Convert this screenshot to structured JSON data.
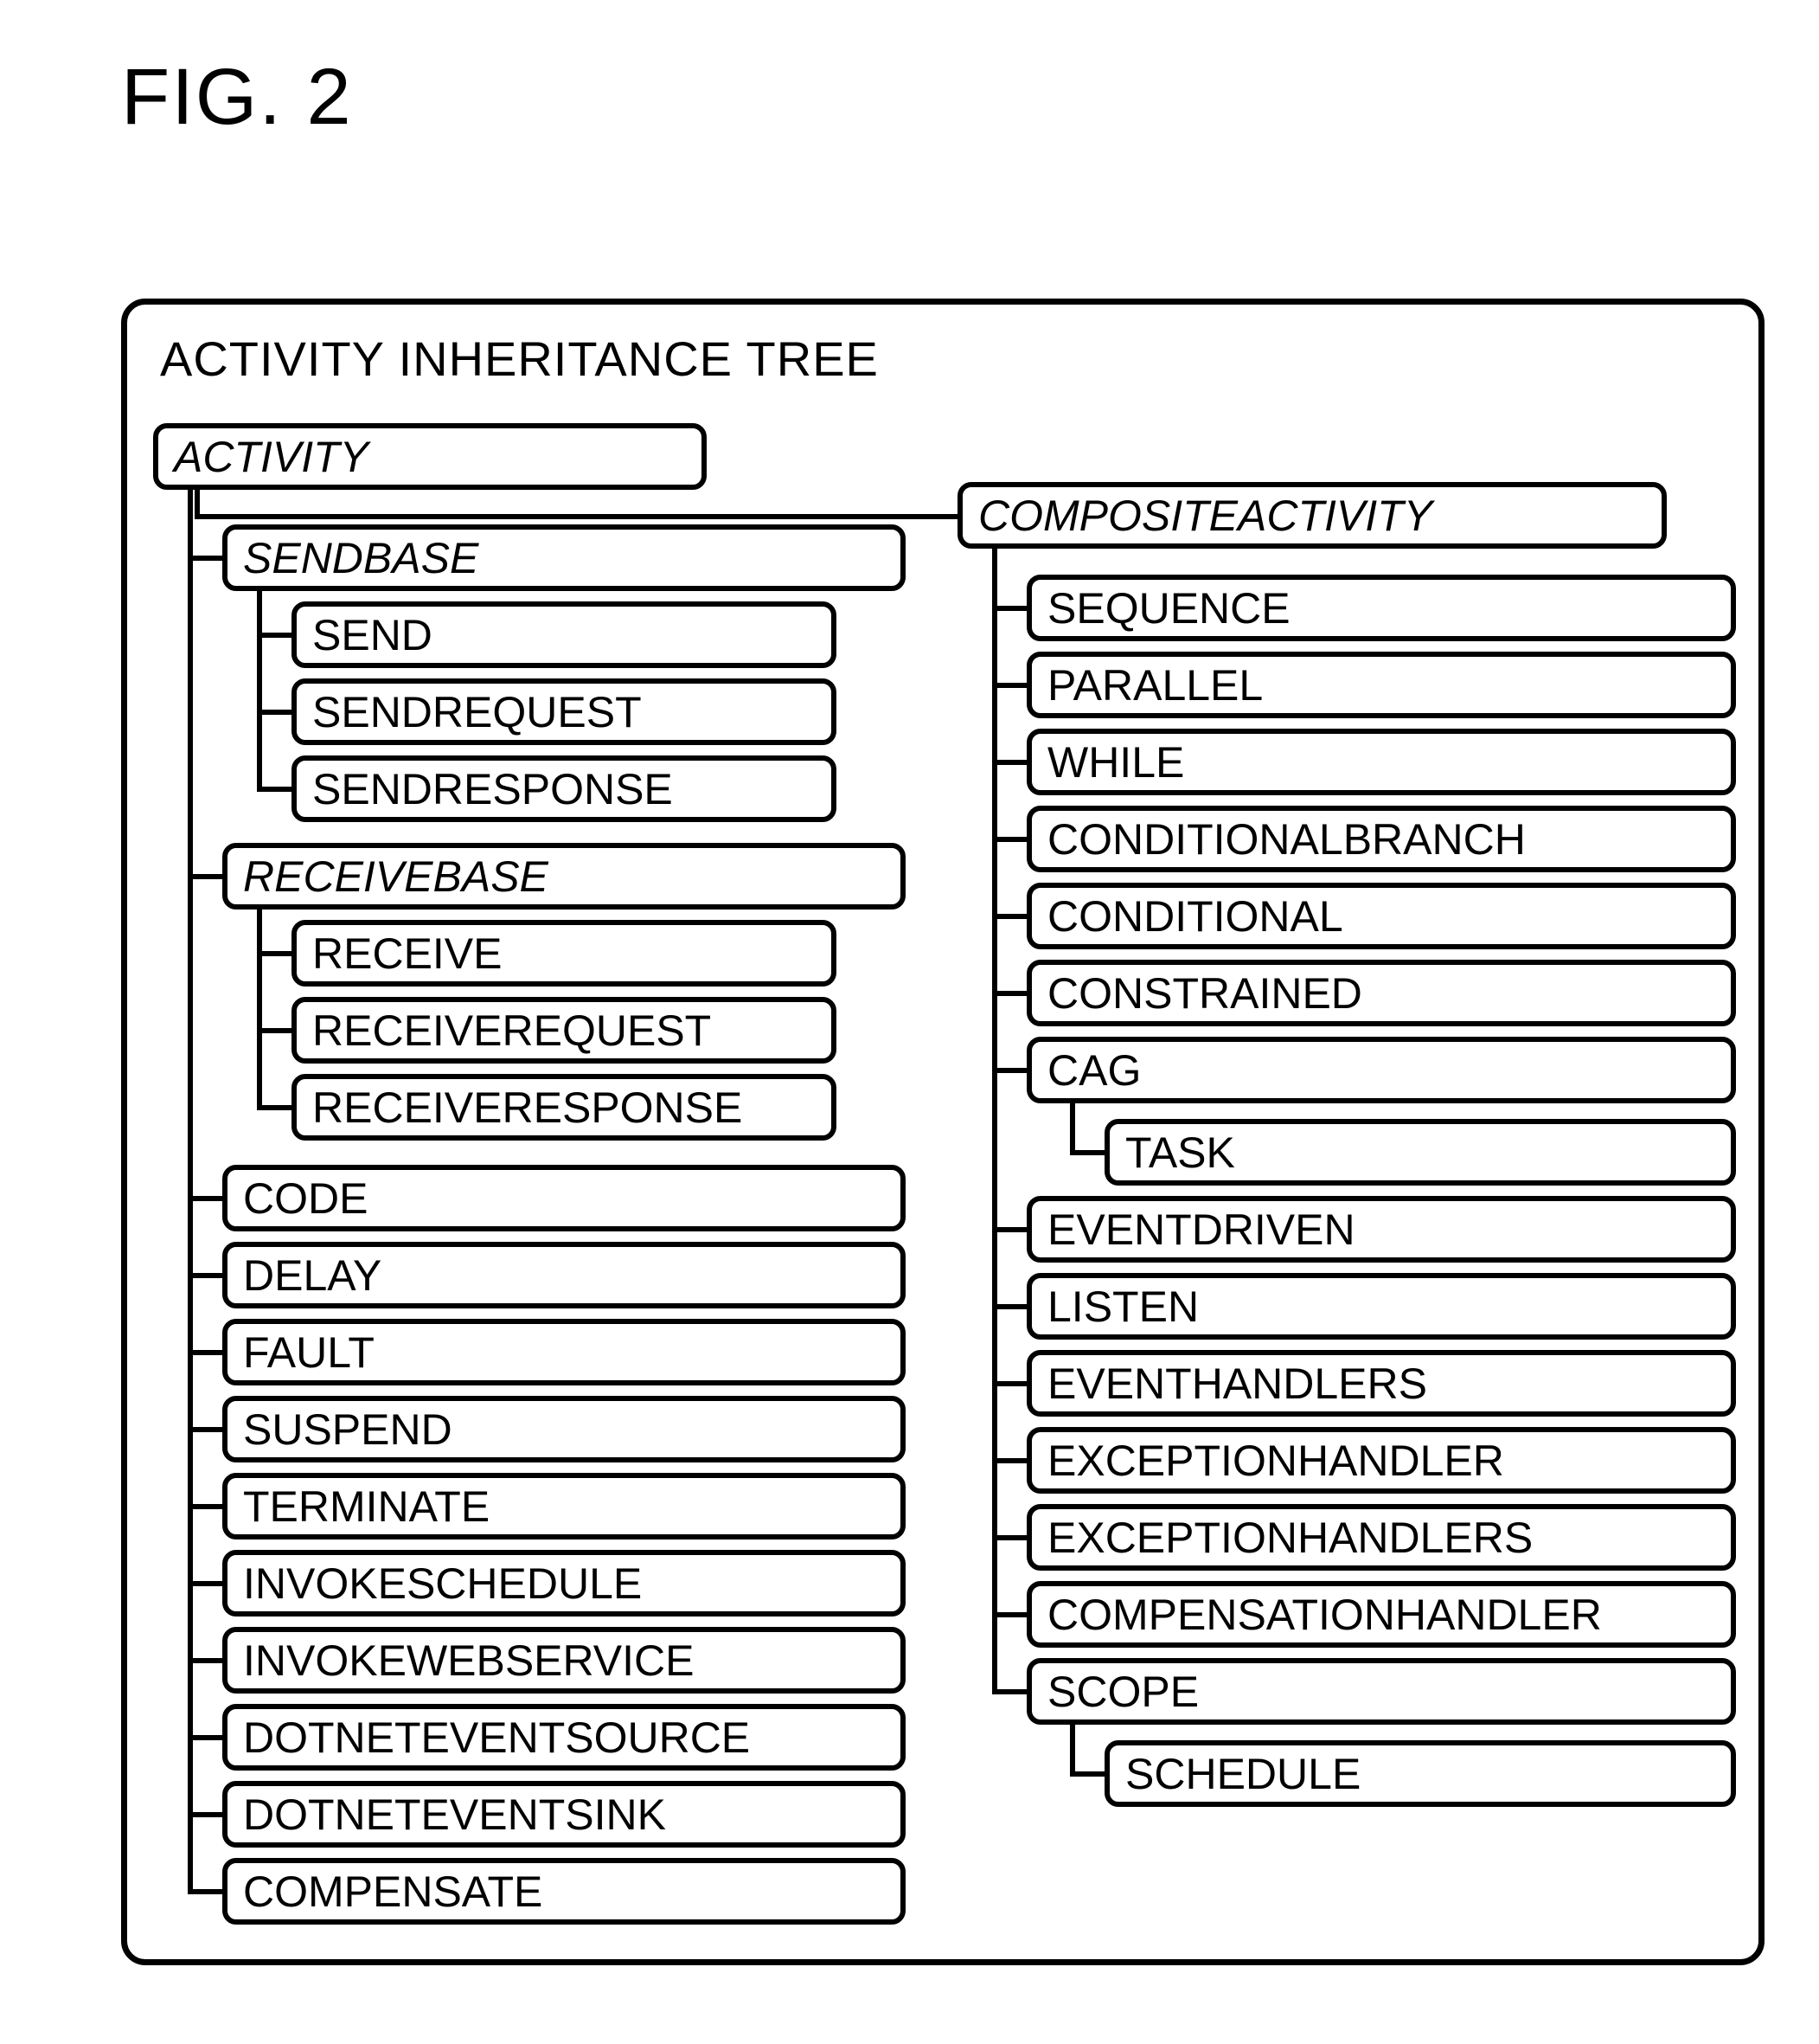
{
  "figure_label": "FIG. 2",
  "panel_title": "ACTIVITY INHERITANCE TREE",
  "left": {
    "root": "ACTIVITY",
    "sendbase": "SENDBASE",
    "sendbase_children": [
      "SEND",
      "SENDREQUEST",
      "SENDRESPONSE"
    ],
    "receivebase": "RECEIVEBASE",
    "receivebase_children": [
      "RECEIVE",
      "RECEIVEREQUEST",
      "RECEIVERESPONSE"
    ],
    "leaves": [
      "CODE",
      "DELAY",
      "FAULT",
      "SUSPEND",
      "TERMINATE",
      "INVOKESCHEDULE",
      "INVOKEWEBSERVICE",
      "DOTNETEVENTSOURCE",
      "DOTNETEVENTSINK",
      "COMPENSATE"
    ]
  },
  "right": {
    "root": "COMPOSITEACTIVITY",
    "items": [
      {
        "label": "SEQUENCE"
      },
      {
        "label": "PARALLEL"
      },
      {
        "label": "WHILE"
      },
      {
        "label": "CONDITIONALBRANCH"
      },
      {
        "label": "CONDITIONAL"
      },
      {
        "label": "CONSTRAINED"
      },
      {
        "label": "CAG",
        "child": "TASK"
      },
      {
        "label": "EVENTDRIVEN"
      },
      {
        "label": "LISTEN"
      },
      {
        "label": "EVENTHANDLERS"
      },
      {
        "label": "EXCEPTIONHANDLER"
      },
      {
        "label": "EXCEPTIONHANDLERS"
      },
      {
        "label": "COMPENSATIONHANDLER"
      },
      {
        "label": "SCOPE",
        "child": "SCHEDULE"
      }
    ]
  },
  "chart_data": {
    "type": "tree",
    "title": "ACTIVITY INHERITANCE TREE",
    "root": {
      "name": "ACTIVITY",
      "abstract": true,
      "children": [
        {
          "name": "SENDBASE",
          "abstract": true,
          "children": [
            {
              "name": "SEND"
            },
            {
              "name": "SENDREQUEST"
            },
            {
              "name": "SENDRESPONSE"
            }
          ]
        },
        {
          "name": "RECEIVEBASE",
          "abstract": true,
          "children": [
            {
              "name": "RECEIVE"
            },
            {
              "name": "RECEIVEREQUEST"
            },
            {
              "name": "RECEIVERESPONSE"
            }
          ]
        },
        {
          "name": "CODE"
        },
        {
          "name": "DELAY"
        },
        {
          "name": "FAULT"
        },
        {
          "name": "SUSPEND"
        },
        {
          "name": "TERMINATE"
        },
        {
          "name": "INVOKESCHEDULE"
        },
        {
          "name": "INVOKEWEBSERVICE"
        },
        {
          "name": "DOTNETEVENTSOURCE"
        },
        {
          "name": "DOTNETEVENTSINK"
        },
        {
          "name": "COMPENSATE"
        },
        {
          "name": "COMPOSITEACTIVITY",
          "abstract": true,
          "children": [
            {
              "name": "SEQUENCE"
            },
            {
              "name": "PARALLEL"
            },
            {
              "name": "WHILE"
            },
            {
              "name": "CONDITIONALBRANCH"
            },
            {
              "name": "CONDITIONAL"
            },
            {
              "name": "CONSTRAINED"
            },
            {
              "name": "CAG",
              "children": [
                {
                  "name": "TASK"
                }
              ]
            },
            {
              "name": "EVENTDRIVEN"
            },
            {
              "name": "LISTEN"
            },
            {
              "name": "EVENTHANDLERS"
            },
            {
              "name": "EXCEPTIONHANDLER"
            },
            {
              "name": "EXCEPTIONHANDLERS"
            },
            {
              "name": "COMPENSATIONHANDLER"
            },
            {
              "name": "SCOPE",
              "children": [
                {
                  "name": "SCHEDULE"
                }
              ]
            }
          ]
        }
      ]
    }
  }
}
